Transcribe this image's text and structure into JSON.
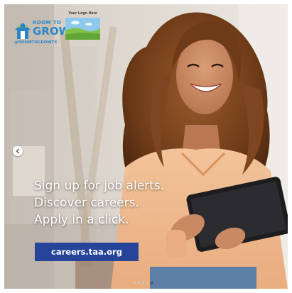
{
  "brand_logo": {
    "icon": "house-icon",
    "text_top": "ROOM TO",
    "text_main": "GROW",
    "handle": "@ROOMTOGROWTX",
    "color": "#2a86c9"
  },
  "partner_logo": {
    "label": "Your Logo Here",
    "icon": "landscape-placeholder-icon"
  },
  "headline": {
    "line1": "Sign up for job alerts.",
    "line2": "Discover careers.",
    "line3": "Apply in a click."
  },
  "cta": {
    "label": "careers.taa.org",
    "color": "#27449b"
  },
  "carousel": {
    "prev_icon": "chevron-left-icon",
    "slide_count": 5,
    "active_index": 4
  }
}
